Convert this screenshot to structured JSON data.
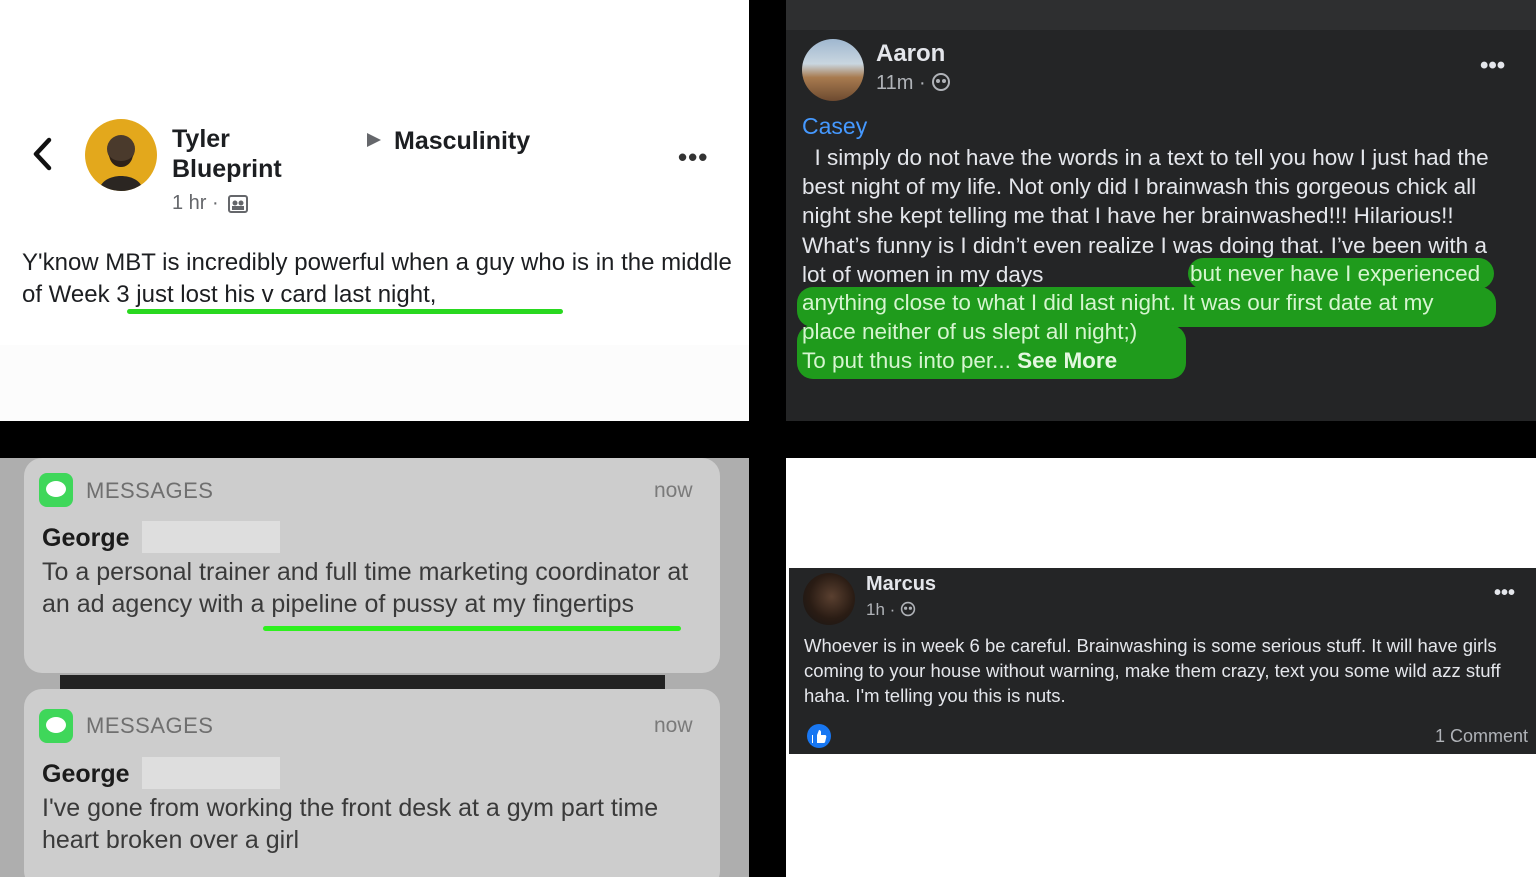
{
  "panel1": {
    "author": "Tyler Blueprint",
    "group": "Masculinity",
    "time": "1 hr ·",
    "body": "Y'know MBT is incredibly powerful when a guy who is in the middle of Week 3 just lost his v card last night,",
    "icons": [
      "back-chevron-icon",
      "play-arrow-icon",
      "more-icon",
      "group-privacy-icon"
    ],
    "accent": "#29d81f"
  },
  "panel2": {
    "author": "Aaron",
    "time": "11m ·",
    "tag": "Casey",
    "text_plain": "I simply do not have the words in a text to tell you how I just had the best night of my life. Not only did I brainwash this gorgeous chick all night she kept telling me that I have her brainwashed!!! Hilarious!! What’s funny is I didn’t even realize I was doing that. I’ve been with a lot of women in my days",
    "hl_line1": "but never have I experienced",
    "hl_line2": "anything close to what I did last night. It was our first date at my",
    "hl_line3": "place neither of us slept all night;)",
    "hl_line4": "To put thus into per...",
    "see_more": "See More",
    "colors": {
      "bg": "#242526",
      "tag": "#4599ff",
      "highlight": "#1f9b1c"
    }
  },
  "panel3": {
    "notif1": {
      "app": "MESSAGES",
      "time": "now",
      "sender": "George",
      "message": "To a personal trainer and full time marketing coordinator at an ad agency with a pipeline of pussy at my fingertips"
    },
    "notif2": {
      "app": "MESSAGES",
      "time": "now",
      "sender": "George",
      "message": "I've gone from working the front desk at a gym part time heart broken over a girl"
    }
  },
  "panel4": {
    "author": "Marcus",
    "time": "1h ·",
    "body": "Whoever is in week 6 be careful. Brainwashing is some serious stuff. It will have girls coming to your house without warning, make them crazy, text you some wild azz stuff haha. I'm telling you this is nuts.",
    "comments": "1 Comment"
  }
}
